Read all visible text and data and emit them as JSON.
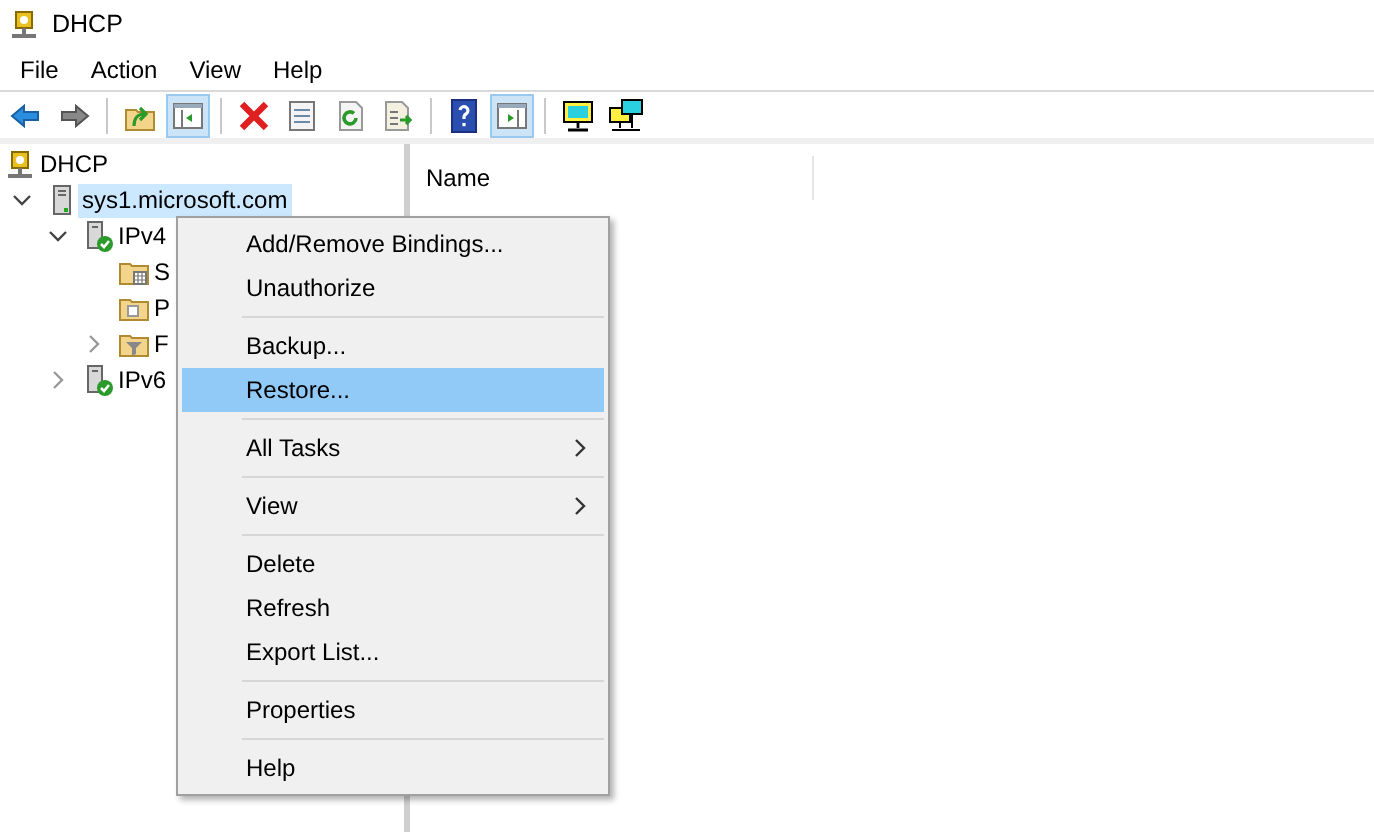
{
  "window": {
    "title": "DHCP"
  },
  "menu_bar": [
    "File",
    "Action",
    "View",
    "Help"
  ],
  "toolbar": [
    {
      "kind": "back",
      "pressed": false
    },
    {
      "kind": "forward",
      "pressed": false
    },
    {
      "kind": "separator"
    },
    {
      "kind": "up",
      "pressed": false
    },
    {
      "kind": "console-tree",
      "pressed": true
    },
    {
      "kind": "separator"
    },
    {
      "kind": "delete",
      "pressed": false
    },
    {
      "kind": "properties",
      "pressed": false
    },
    {
      "kind": "refresh",
      "pressed": false
    },
    {
      "kind": "export",
      "pressed": false
    },
    {
      "kind": "separator"
    },
    {
      "kind": "help",
      "pressed": false
    },
    {
      "kind": "action-pane",
      "pressed": true
    },
    {
      "kind": "separator"
    },
    {
      "kind": "monitor",
      "pressed": false
    },
    {
      "kind": "network",
      "pressed": false
    }
  ],
  "tree": [
    {
      "label": "DHCP",
      "kind": "dhcp",
      "selected": false,
      "children": [
        {
          "label": "sys1.microsoft.com",
          "kind": "server",
          "selected": true,
          "expanded": true,
          "children": [
            {
              "label": "IPv4",
              "kind": "server-ok",
              "selected": false,
              "expanded": true,
              "children": [
                {
                  "label": "S",
                  "kind": "folder-grid",
                  "selected": false
                },
                {
                  "label": "P",
                  "kind": "folder",
                  "selected": false
                },
                {
                  "label": "F",
                  "kind": "folder-filter",
                  "selected": false,
                  "expanded": false
                }
              ]
            },
            {
              "label": "IPv6",
              "kind": "server-ok",
              "selected": false,
              "expanded": false
            }
          ]
        }
      ]
    }
  ],
  "list": {
    "columns": [
      "Name"
    ]
  },
  "context_menu": [
    {
      "kind": "item",
      "label": "Add/Remove Bindings...",
      "selected": false
    },
    {
      "kind": "item",
      "label": "Unauthorize",
      "selected": false
    },
    {
      "kind": "separator"
    },
    {
      "kind": "item",
      "label": "Backup...",
      "selected": false
    },
    {
      "kind": "item",
      "label": "Restore...",
      "selected": true
    },
    {
      "kind": "separator"
    },
    {
      "kind": "item",
      "label": "All Tasks",
      "selected": false,
      "submenu": true
    },
    {
      "kind": "separator"
    },
    {
      "kind": "item",
      "label": "View",
      "selected": false,
      "submenu": true
    },
    {
      "kind": "separator"
    },
    {
      "kind": "item",
      "label": "Delete",
      "selected": false
    },
    {
      "kind": "item",
      "label": "Refresh",
      "selected": false
    },
    {
      "kind": "item",
      "label": "Export List...",
      "selected": false
    },
    {
      "kind": "separator"
    },
    {
      "kind": "item",
      "label": "Properties",
      "selected": false
    },
    {
      "kind": "separator"
    },
    {
      "kind": "item",
      "label": "Help",
      "selected": false
    }
  ]
}
